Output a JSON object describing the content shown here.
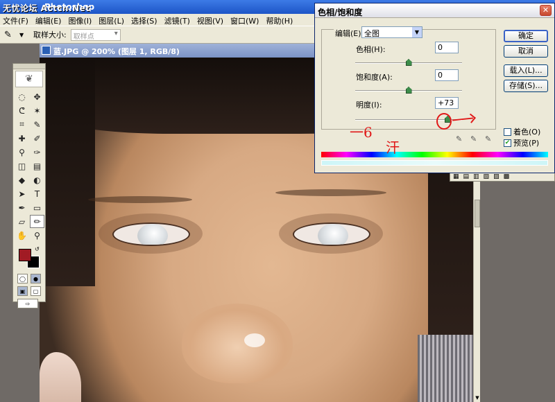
{
  "app": {
    "title": "Photoshop",
    "watermark": "无忧论坛 Actcn.Net"
  },
  "menu": [
    "文件(F)",
    "编辑(E)",
    "图像(I)",
    "图层(L)",
    "选择(S)",
    "滤镜(T)",
    "视图(V)",
    "窗口(W)",
    "帮助(H)"
  ],
  "options_bar": {
    "sample_size_label": "取样大小:",
    "sample_size_value": "取样点",
    "tool_icon": "eyedropper-icon"
  },
  "document": {
    "title": "蓝.JPG @ 200% (图层 1, RGB/8)"
  },
  "toolbox": {
    "tools": [
      {
        "name": "marquee-tool",
        "glyph": "◌"
      },
      {
        "name": "move-tool",
        "glyph": "✥"
      },
      {
        "name": "lasso-tool",
        "glyph": "ᕦ"
      },
      {
        "name": "magic-wand-tool",
        "glyph": "✶"
      },
      {
        "name": "crop-tool",
        "glyph": "⌗"
      },
      {
        "name": "slice-tool",
        "glyph": "✎"
      },
      {
        "name": "healing-tool",
        "glyph": "✚"
      },
      {
        "name": "brush-tool",
        "glyph": "✐"
      },
      {
        "name": "stamp-tool",
        "glyph": "⚲"
      },
      {
        "name": "history-brush-tool",
        "glyph": "✑"
      },
      {
        "name": "eraser-tool",
        "glyph": "◫"
      },
      {
        "name": "gradient-tool",
        "glyph": "▤"
      },
      {
        "name": "blur-tool",
        "glyph": "◆"
      },
      {
        "name": "dodge-tool",
        "glyph": "◐"
      },
      {
        "name": "path-select-tool",
        "glyph": "➤"
      },
      {
        "name": "type-tool",
        "glyph": "T"
      },
      {
        "name": "pen-tool",
        "glyph": "✒"
      },
      {
        "name": "shape-tool",
        "glyph": "▭"
      },
      {
        "name": "notes-tool",
        "glyph": "▱"
      },
      {
        "name": "eyedropper-tool",
        "glyph": "✏"
      },
      {
        "name": "hand-tool",
        "glyph": "✋"
      },
      {
        "name": "zoom-tool",
        "glyph": "⚲"
      }
    ],
    "foreground_color": "#a11b24",
    "background_color": "#000000"
  },
  "dialog": {
    "title": "色相/饱和度",
    "edit_label": "编辑(E):",
    "edit_value": "全图",
    "hue_label": "色相(H):",
    "hue_value": "0",
    "saturation_label": "饱和度(A):",
    "saturation_value": "0",
    "lightness_label": "明度(I):",
    "lightness_value": "+73",
    "hue_slider_fraction": 0.5,
    "saturation_slider_fraction": 0.5,
    "lightness_slider_fraction": 0.865,
    "buttons": {
      "ok": "确定",
      "cancel": "取消",
      "load": "载入(L)...",
      "save": "存储(S)..."
    },
    "colorize_label": "着色(O)",
    "colorize_checked": false,
    "preview_label": "预览(P)",
    "preview_checked": true
  },
  "annotation": {
    "left_scribble": "一6",
    "right_scribble": "汗"
  }
}
